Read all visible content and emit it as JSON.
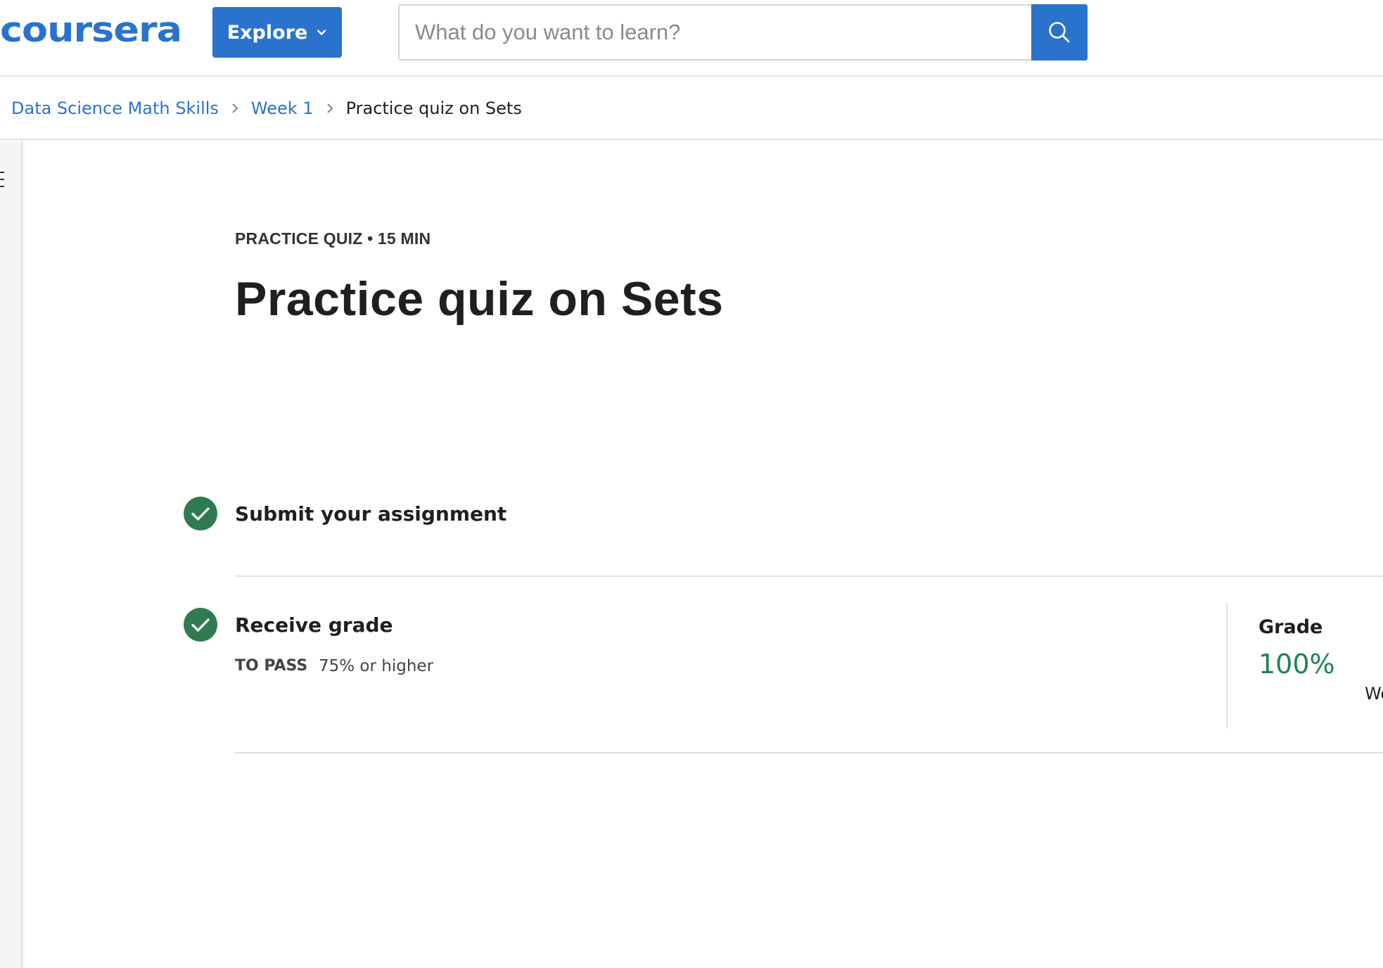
{
  "header": {
    "logo": "coursera",
    "explore_label": "Explore",
    "search_placeholder": "What do you want to learn?"
  },
  "breadcrumb": [
    {
      "label": "Data Science Math Skills"
    },
    {
      "label": "Week 1"
    },
    {
      "label": "Practice quiz on Sets"
    }
  ],
  "main": {
    "eyebrow": "PRACTICE QUIZ • 15 MIN",
    "title": "Practice quiz on Sets",
    "steps": {
      "submit": {
        "title": "Submit your assignment",
        "status": "complete"
      },
      "receive": {
        "title": "Receive grade",
        "status": "complete",
        "pass_label": "TO PASS",
        "pass_value": "75% or higher"
      }
    },
    "grade": {
      "label": "Grade",
      "value": "100%",
      "trailing_text": "We"
    }
  },
  "colors": {
    "brand": "#2a73cc",
    "success": "#1f8354",
    "check_bg": "#2f7a51"
  },
  "icons": [
    "chevron-down-icon",
    "search-icon",
    "chevron-right-icon",
    "menu-icon",
    "check-circle-icon"
  ]
}
